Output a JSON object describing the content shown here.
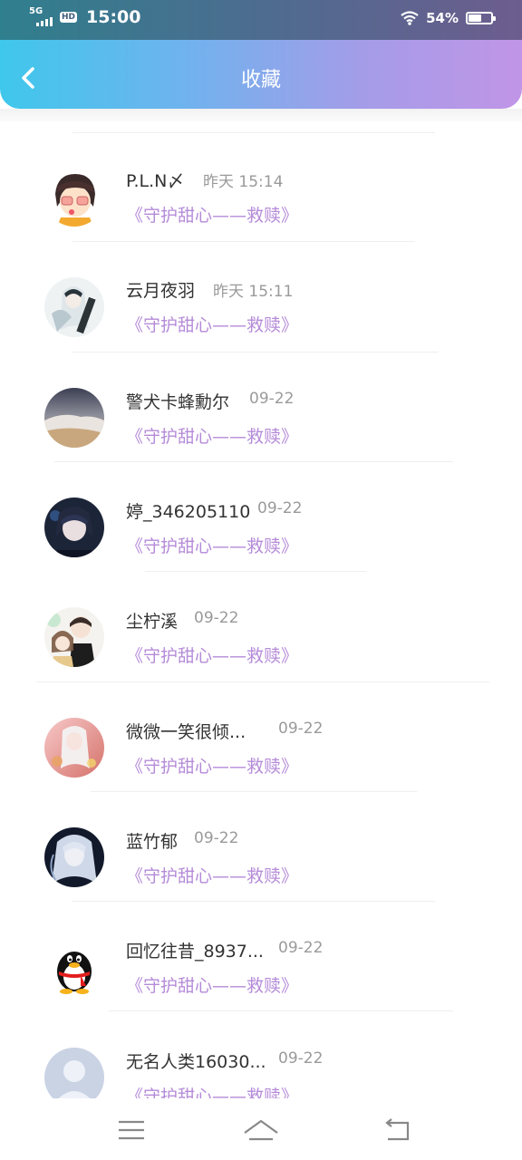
{
  "status_bar": {
    "network": "5G",
    "hd": "HD",
    "time": "15:00",
    "battery": "54%",
    "battery_level": 0.54
  },
  "header": {
    "title": "收藏"
  },
  "colors": {
    "name": "#333333",
    "time": "#9a9a9a",
    "book": "#b58bd8",
    "gradient_start": "#3fc7ec",
    "gradient_end": "#c195e7"
  },
  "items": [
    {
      "name": "P.L.N〆",
      "time": "昨天 15:14",
      "book": "《守护甜心——救赎》",
      "avatar": "anime-girl-glasses"
    },
    {
      "name": "云月夜羽",
      "time": "昨天 15:11",
      "book": "《守护甜心——救赎》",
      "avatar": "anime-white-hair"
    },
    {
      "name": "警犬卡蜂勳尔",
      "time": "09-22",
      "book": "《守护甜心——救赎》",
      "avatar": "snow-landscape"
    },
    {
      "name": "婷_346205110",
      "time": "09-22",
      "book": "《守护甜心——救赎》",
      "avatar": "anime-dark-boy"
    },
    {
      "name": "尘柠溪",
      "time": "09-22",
      "book": "《守护甜心——救赎》",
      "avatar": "anime-couple"
    },
    {
      "name": "微微一笑很倾...",
      "time": "09-22",
      "book": "《守护甜心——救赎》",
      "avatar": "anime-pink"
    },
    {
      "name": "蓝竹郁",
      "time": "09-22",
      "book": "《守护甜心——救赎》",
      "avatar": "anime-silver"
    },
    {
      "name": "回忆往昔_8937...",
      "time": "09-22",
      "book": "《守护甜心——救赎》",
      "avatar": "qq-penguin"
    },
    {
      "name": "无名人类16030...",
      "time": "09-22",
      "book": "《守护甜心——救赎》",
      "avatar": "default-user"
    }
  ],
  "bottom_nav": {
    "menu": "menu-icon",
    "home": "home-icon",
    "back": "back-icon"
  }
}
